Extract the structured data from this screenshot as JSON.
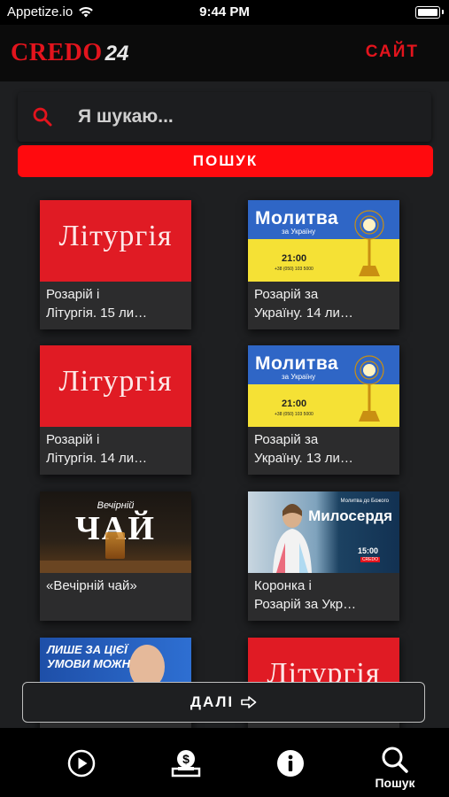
{
  "status_bar": {
    "carrier": "Appetize.io",
    "time": "9:44 PM"
  },
  "header": {
    "logo_text": "CREDO",
    "logo_number": "24",
    "site_link": "САЙТ"
  },
  "search": {
    "placeholder": "Я шукаю...",
    "button_label": "ПОШУК"
  },
  "cards": [
    {
      "title": "Розарій і\nЛітургія. 15 ли…",
      "thumb": "liturgy",
      "thumb_text": "Літургія"
    },
    {
      "title": "Розарій за\nУкраїну. 14 ли…",
      "thumb": "prayer",
      "thumb_text": "Молитва",
      "thumb_sub": "за Україну",
      "thumb_time": "21:00",
      "thumb_phone": "+38 (050) 103 5000"
    },
    {
      "title": "Розарій і\nЛітургія. 14 ли…",
      "thumb": "liturgy",
      "thumb_text": "Літургія"
    },
    {
      "title": "Розарій за\nУкраїну. 13 ли…",
      "thumb": "prayer",
      "thumb_text": "Молитва",
      "thumb_sub": "за Україну",
      "thumb_time": "21:00",
      "thumb_phone": "+38 (050) 103 5000"
    },
    {
      "title": "«Вечірній чай»",
      "thumb": "tea",
      "thumb_small": "Вечірній",
      "thumb_text": "ЧАЙ"
    },
    {
      "title": "Коронка і\nРозарій за Укр…",
      "thumb": "mercy",
      "thumb_small": "Молитва до Божого",
      "thumb_text": "Милосердя",
      "thumb_time": "15:00",
      "thumb_brand": "CREDO"
    },
    {
      "title": "",
      "thumb": "blue",
      "thumb_text": "ЛИШЕ ЗА ЦІЄЇ\nУМОВИ МОЖНА"
    },
    {
      "title": "",
      "thumb": "liturgy",
      "thumb_text": "Літургія"
    }
  ],
  "more_button": {
    "label": "ДАЛІ",
    "icon": "arrow-right-icon"
  },
  "tab_bar": {
    "tabs": [
      {
        "icon": "play-circle-icon",
        "label": ""
      },
      {
        "icon": "donate-icon",
        "label": ""
      },
      {
        "icon": "info-icon",
        "label": ""
      },
      {
        "icon": "search-icon",
        "label": "Пошук",
        "active": true
      }
    ]
  },
  "colors": {
    "accent": "#e3141d",
    "background": "#1e1f21",
    "card": "#2c2c2d"
  }
}
